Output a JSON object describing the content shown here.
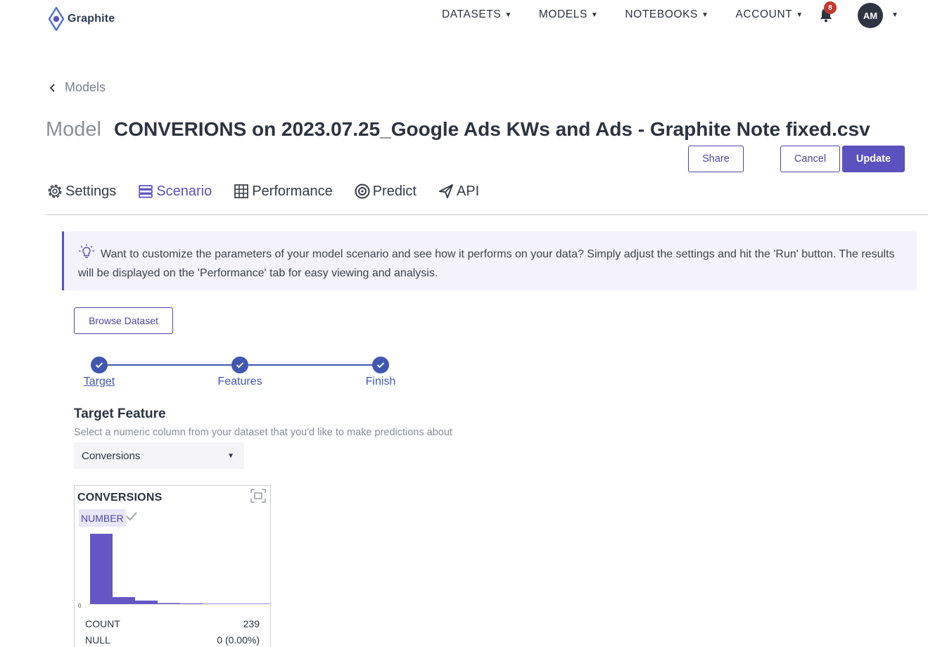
{
  "brand": {
    "name": "Graphite",
    "accent": "#5b52c0"
  },
  "nav": {
    "items": [
      {
        "label": "DATASETS"
      },
      {
        "label": "MODELS"
      },
      {
        "label": "NOTEBOOKS"
      },
      {
        "label": "ACCOUNT"
      }
    ],
    "notification_count": "8",
    "avatar_initials": "AM"
  },
  "breadcrumb": {
    "label": "Models"
  },
  "page": {
    "title_prefix": "Model",
    "title": "CONVERIONS on 2023.07.25_Google Ads KWs and Ads - Graphite Note fixed.csv"
  },
  "actions": {
    "share": "Share",
    "cancel": "Cancel",
    "update": "Update"
  },
  "tabs": [
    {
      "label": "Settings",
      "icon": "gear-icon"
    },
    {
      "label": "Scenario",
      "icon": "layers-icon",
      "active": true
    },
    {
      "label": "Performance",
      "icon": "grid-icon"
    },
    {
      "label": "Predict",
      "icon": "target-icon"
    },
    {
      "label": "API",
      "icon": "share-icon"
    }
  ],
  "info": {
    "icon": "lightbulb-icon",
    "text": "Want to customize the parameters of your model scenario and see how it performs on your data? Simply adjust the settings and hit the 'Run' button. The results will be displayed on the 'Performance' tab for easy viewing and analysis."
  },
  "browse_button": "Browse Dataset",
  "stepper": {
    "steps": [
      {
        "label": "Target",
        "done": true,
        "current": true
      },
      {
        "label": "Features",
        "done": true
      },
      {
        "label": "Finish",
        "done": true
      }
    ]
  },
  "target": {
    "heading": "Target Feature",
    "description": "Select a numeric column from your dataset that you'd like to make predictions about",
    "selected": "Conversions"
  },
  "feature_card": {
    "name": "CONVERSIONS",
    "type": "NUMBER",
    "axis_zero": "0",
    "histogram": [
      1.0,
      0.1,
      0.05,
      0.015,
      0.01,
      0.004,
      0.002,
      0.002
    ],
    "bar_color": "#6556c4",
    "stats": [
      {
        "label": "COUNT",
        "value": "239"
      },
      {
        "label": "NULL",
        "value": "0 (0.00%)"
      }
    ]
  }
}
